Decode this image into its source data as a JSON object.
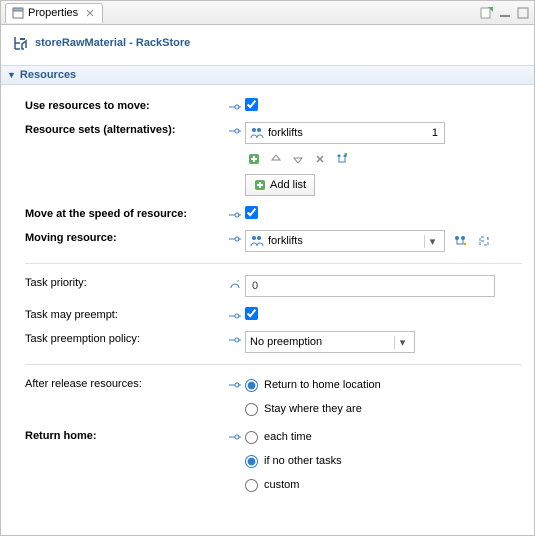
{
  "tabbar": {
    "title": "Properties"
  },
  "title": {
    "name": "storeRawMaterial",
    "type": "RackStore"
  },
  "section": {
    "title": "Resources"
  },
  "labels": {
    "useResources": "Use resources to move:",
    "resourceSets": "Resource sets (alternatives):",
    "addList": "Add list",
    "moveAtSpeed": "Move at the speed of resource:",
    "movingResource": "Moving resource:",
    "taskPriority": "Task priority:",
    "taskMayPreempt": "Task may preempt:",
    "preemptionPolicy": "Task preemption policy:",
    "afterRelease": "After release resources:",
    "returnHome": "Return home:"
  },
  "values": {
    "useResources": true,
    "resourceSet": {
      "name": "forklifts",
      "qty": "1"
    },
    "moveAtSpeed": true,
    "movingResource": "forklifts",
    "taskPriority": "0",
    "taskMayPreempt": true,
    "preemptionPolicy": "No preemption",
    "afterReleaseOptions": [
      "Return to home location",
      "Stay where they are"
    ],
    "afterReleaseSelected": 0,
    "returnHomeOptions": [
      "each time",
      "if no other tasks",
      "custom"
    ],
    "returnHomeSelected": 1
  }
}
